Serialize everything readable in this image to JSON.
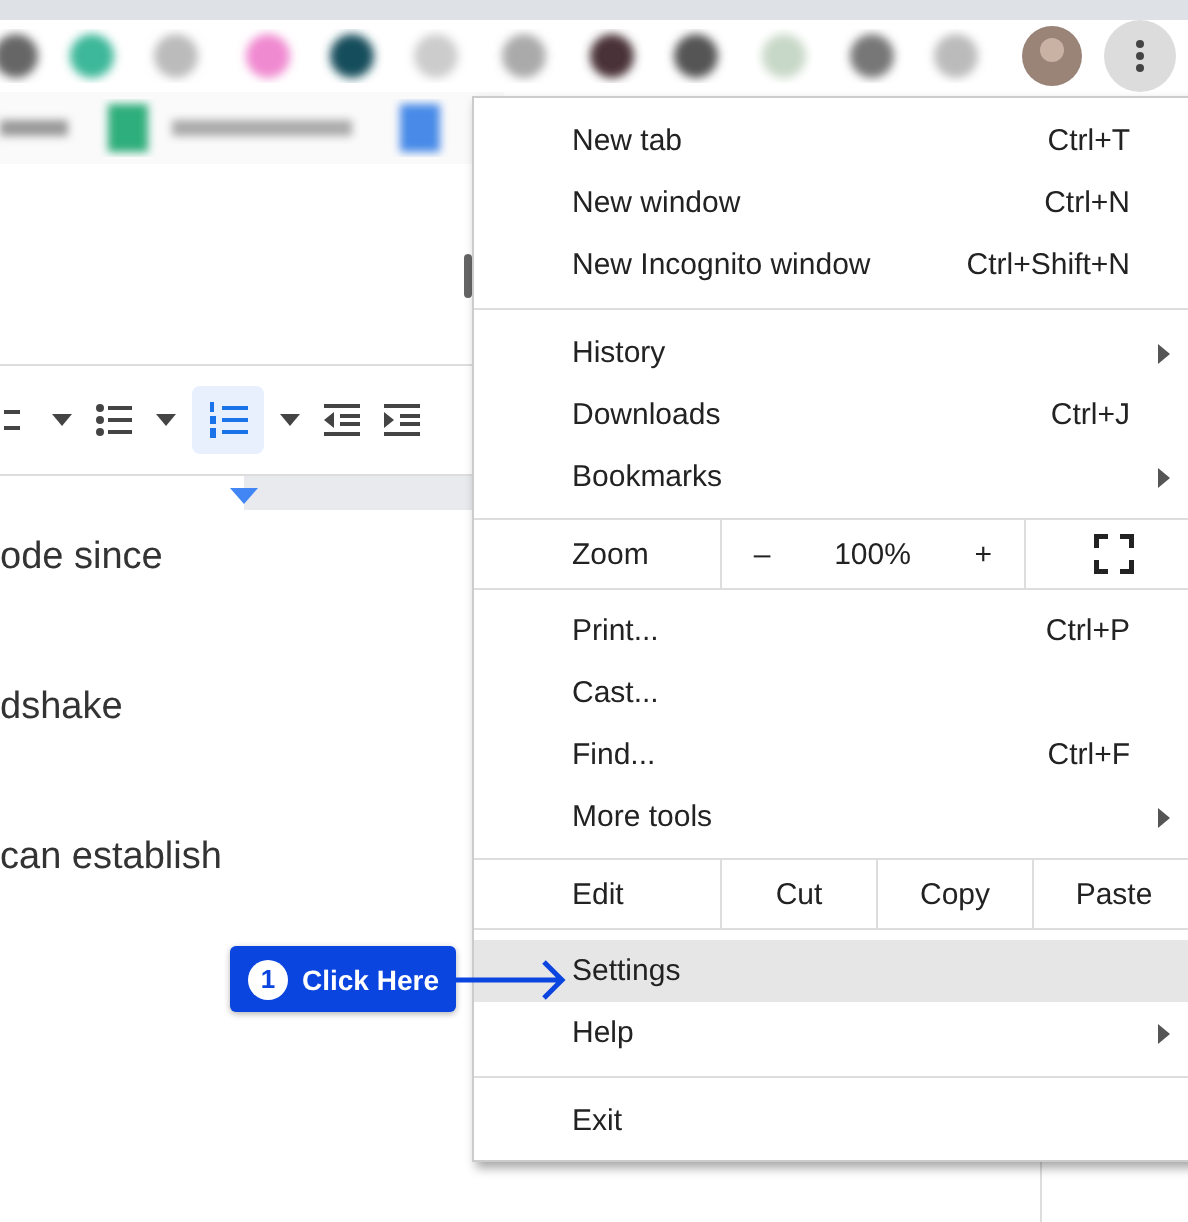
{
  "doc_toolbar": [
    {
      "kind": "align",
      "selected": false
    },
    {
      "kind": "caret",
      "selected": false
    },
    {
      "kind": "bullets",
      "selected": false
    },
    {
      "kind": "caret",
      "selected": false
    },
    {
      "kind": "numbered",
      "selected": true
    },
    {
      "kind": "caret",
      "selected": false
    },
    {
      "kind": "outdent",
      "selected": false
    },
    {
      "kind": "indent",
      "selected": false
    }
  ],
  "doc_lines": [
    "ode since",
    "dshake",
    "can establish"
  ],
  "menu": {
    "rows": [
      {
        "kind": "item",
        "label": "New tab",
        "shortcut": "Ctrl+T",
        "submenu": false,
        "selected": false
      },
      {
        "kind": "item",
        "label": "New window",
        "shortcut": "Ctrl+N",
        "submenu": false,
        "selected": false
      },
      {
        "kind": "item",
        "label": "New Incognito window",
        "shortcut": "Ctrl+Shift+N",
        "submenu": false,
        "selected": false
      },
      {
        "kind": "separator"
      },
      {
        "kind": "item",
        "label": "History",
        "submenu": true,
        "selected": false
      },
      {
        "kind": "item",
        "label": "Downloads",
        "shortcut": "Ctrl+J",
        "submenu": false,
        "selected": false
      },
      {
        "kind": "item",
        "label": "Bookmarks",
        "submenu": true,
        "selected": false
      },
      {
        "kind": "zoom",
        "label": "Zoom",
        "minus": "–",
        "value": "100%",
        "plus": "+"
      },
      {
        "kind": "item",
        "label": "Print...",
        "shortcut": "Ctrl+P",
        "submenu": false,
        "selected": false
      },
      {
        "kind": "item",
        "label": "Cast...",
        "submenu": false,
        "selected": false
      },
      {
        "kind": "item",
        "label": "Find...",
        "shortcut": "Ctrl+F",
        "submenu": false,
        "selected": false
      },
      {
        "kind": "item",
        "label": "More tools",
        "submenu": true,
        "selected": false
      },
      {
        "kind": "edit",
        "label": "Edit",
        "buttons": [
          "Cut",
          "Copy",
          "Paste"
        ]
      },
      {
        "kind": "item",
        "label": "Settings",
        "submenu": false,
        "selected": true
      },
      {
        "kind": "item",
        "label": "Help",
        "submenu": true,
        "selected": false
      },
      {
        "kind": "separator"
      },
      {
        "kind": "item",
        "label": "Exit",
        "submenu": false,
        "selected": false
      }
    ]
  },
  "callout": {
    "step": "1",
    "label": "Click Here"
  }
}
